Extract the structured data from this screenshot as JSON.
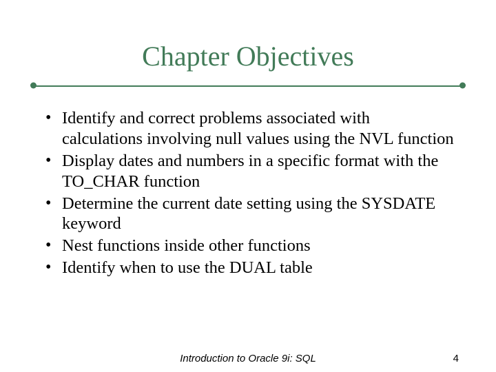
{
  "title": "Chapter Objectives",
  "bullets": [
    "Identify and correct problems associated with calculations involving null values using the NVL function",
    "Display dates and numbers in a specific format with the TO_CHAR function",
    "Determine the current date setting using the SYSDATE keyword",
    "Nest functions inside other functions",
    "Identify when to use the DUAL table"
  ],
  "footer": {
    "center": "Introduction to Oracle 9i: SQL",
    "page": "4"
  },
  "colors": {
    "accent": "#427b58"
  }
}
